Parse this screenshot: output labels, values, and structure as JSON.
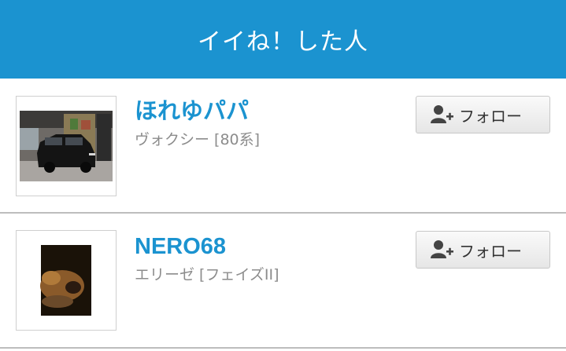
{
  "header": {
    "title": "イイね！した人"
  },
  "users": [
    {
      "name": "ほれゆパパ",
      "car": "ヴォクシー [80系]",
      "follow_label": "フォロー",
      "avatar_icon": "car-photo"
    },
    {
      "name": "NERO68",
      "car": "エリーゼ [フェイズII]",
      "follow_label": "フォロー",
      "avatar_icon": "dog-photo"
    }
  ],
  "colors": {
    "header_bg": "#1b93d0",
    "username": "#1b93d0",
    "subtext": "#8c8c8c"
  }
}
